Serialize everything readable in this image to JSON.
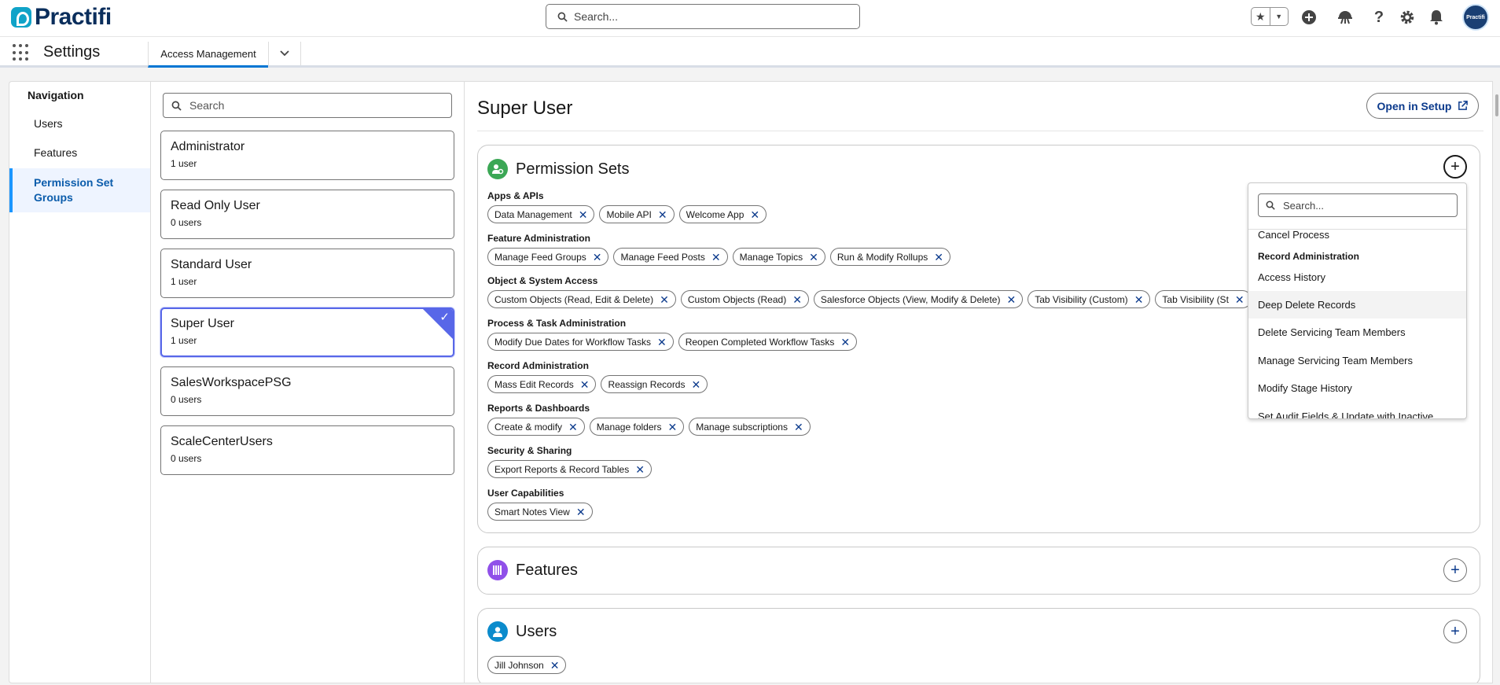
{
  "header": {
    "logo_text": "Practifi",
    "search_placeholder": "Search...",
    "avatar_text": "Practifi"
  },
  "appnav": {
    "app_name": "Settings",
    "tab_label": "Access Management"
  },
  "left_nav": {
    "heading": "Navigation",
    "items": [
      {
        "label": "Users"
      },
      {
        "label": "Features"
      },
      {
        "label": "Permission Set Groups"
      }
    ]
  },
  "groups": {
    "search_placeholder": "Search",
    "items": [
      {
        "title": "Administrator",
        "subtitle": "1 user"
      },
      {
        "title": "Read Only User",
        "subtitle": "0 users"
      },
      {
        "title": "Standard User",
        "subtitle": "1 user"
      },
      {
        "title": "Super User",
        "subtitle": "1 user"
      },
      {
        "title": "SalesWorkspacePSG",
        "subtitle": "0 users"
      },
      {
        "title": "ScaleCenterUsers",
        "subtitle": "0 users"
      }
    ]
  },
  "main": {
    "title": "Super User",
    "open_setup_label": "Open in Setup",
    "permission_sets": {
      "title": "Permission Sets",
      "categories": [
        {
          "name": "Apps & APIs",
          "pills": [
            "Data Management",
            "Mobile API",
            "Welcome App"
          ]
        },
        {
          "name": "Feature Administration",
          "pills": [
            "Manage Feed Groups",
            "Manage Feed Posts",
            "Manage Topics",
            "Run & Modify Rollups"
          ]
        },
        {
          "name": "Object & System Access",
          "pills": [
            "Custom Objects (Read, Edit & Delete)",
            "Custom Objects (Read)",
            "Salesforce Objects (View, Modify & Delete)",
            "Tab Visibility (Custom)",
            "Tab Visibility (St"
          ]
        },
        {
          "name": "Process & Task Administration",
          "pills": [
            "Modify Due Dates for Workflow Tasks",
            "Reopen Completed Workflow Tasks"
          ]
        },
        {
          "name": "Record Administration",
          "pills": [
            "Mass Edit Records",
            "Reassign Records"
          ]
        },
        {
          "name": "Reports & Dashboards",
          "pills": [
            "Create & modify",
            "Manage folders",
            "Manage subscriptions"
          ]
        },
        {
          "name": "Security & Sharing",
          "pills": [
            "Export Reports & Record Tables"
          ]
        },
        {
          "name": "User Capabilities",
          "pills": [
            "Smart Notes View"
          ]
        }
      ]
    },
    "features": {
      "title": "Features"
    },
    "users": {
      "title": "Users",
      "pills": [
        "Jill Johnson"
      ]
    }
  },
  "dropdown": {
    "search_placeholder": "Search...",
    "partial_top": "Cancel Process",
    "group_label": "Record Administration",
    "items": [
      "Access History",
      "Deep Delete Records",
      "Delete Servicing Team Members",
      "Manage Servicing Team Members",
      "Modify Stage History"
    ],
    "partial_bottom": "Set Audit Fields & Update with Inactive"
  },
  "colors": {
    "accent": "#5867e8",
    "brand_blue": "#0176d3",
    "link_blue": "#0b3a8c",
    "permission_icon": "#3ba755",
    "features_icon": "#9050e9",
    "users_icon": "#0b8bcc"
  }
}
